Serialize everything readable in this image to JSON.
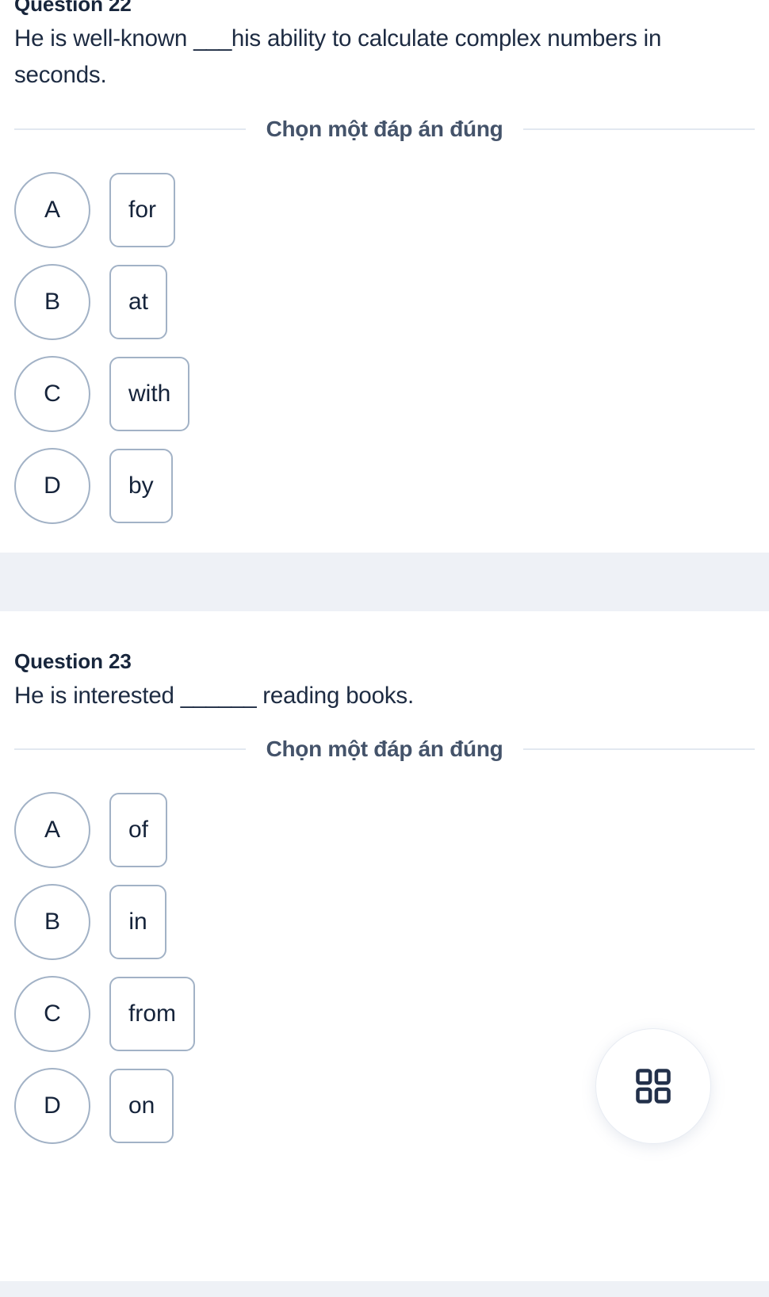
{
  "app": {
    "choose_label": "Chọn một đáp án đúng",
    "fab_icon": "grid-icon",
    "colors": {
      "text_dark": "#1d2b42",
      "title_dark": "#18263c",
      "border": "#a2b2c6",
      "divider": "#e2e8f0",
      "band": "#eef1f6",
      "label": "#44536a"
    }
  },
  "questions": [
    {
      "title": "Question 22",
      "text_before": "He is well-known ",
      "blank": "___",
      "text_after": "his ability to calculate complex numbers in seconds.",
      "options": [
        {
          "letter": "A",
          "value": "for"
        },
        {
          "letter": "B",
          "value": "at"
        },
        {
          "letter": "C",
          "value": "with"
        },
        {
          "letter": "D",
          "value": "by"
        }
      ]
    },
    {
      "title": "Question 23",
      "text_before": "He is interested ",
      "blank": "______",
      "text_after": " reading books.",
      "options": [
        {
          "letter": "A",
          "value": "of"
        },
        {
          "letter": "B",
          "value": "in"
        },
        {
          "letter": "C",
          "value": "from"
        },
        {
          "letter": "D",
          "value": "on"
        }
      ]
    }
  ]
}
